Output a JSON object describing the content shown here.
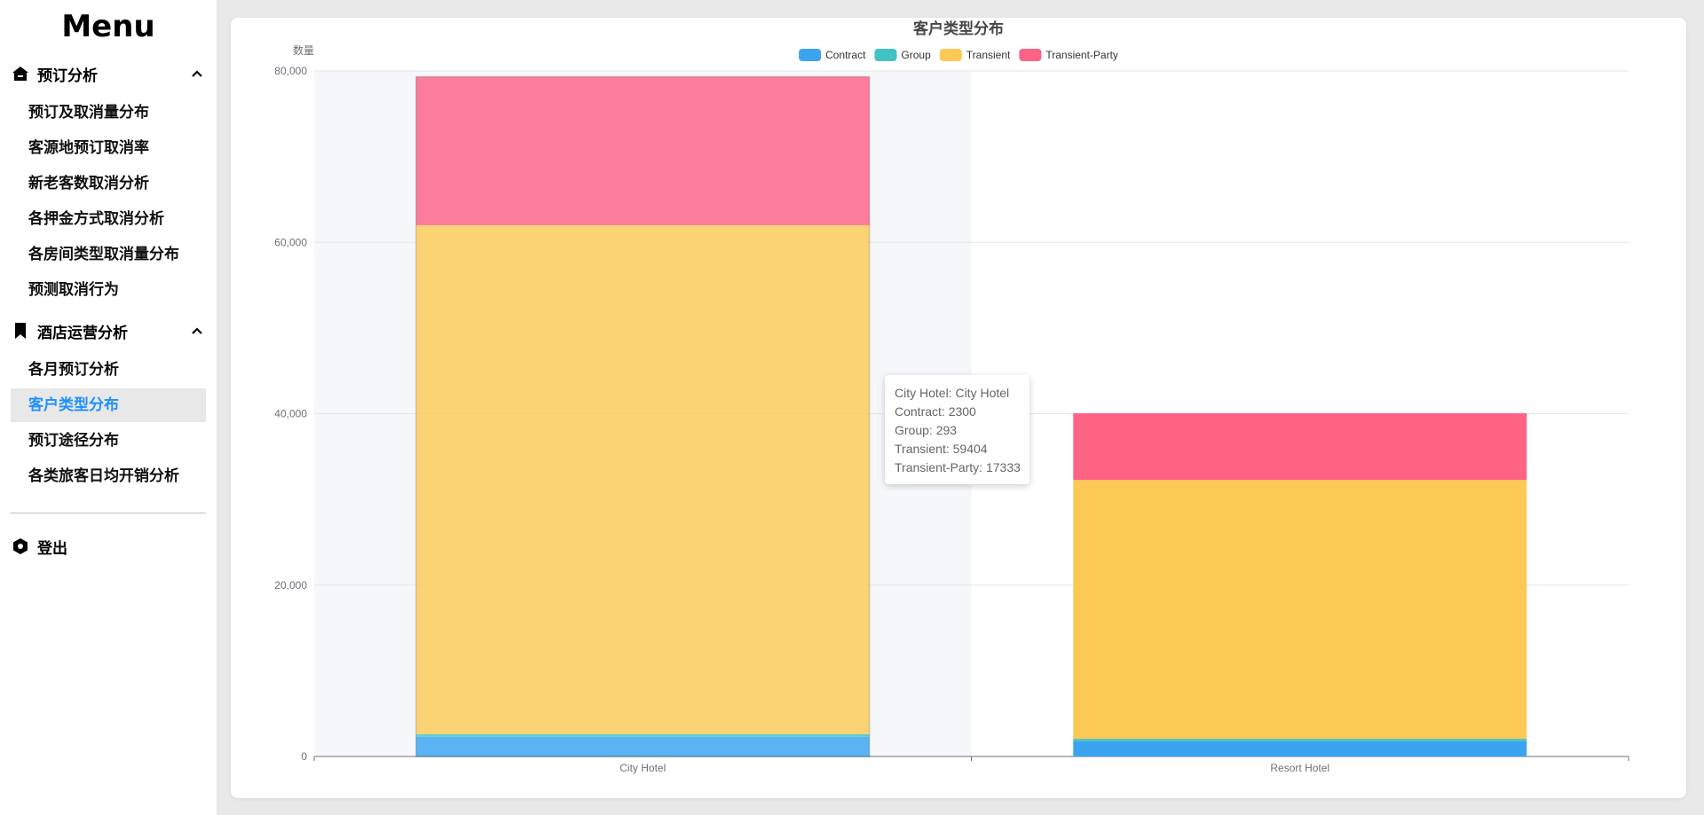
{
  "sidebar": {
    "title": "Menu",
    "groups": [
      {
        "label": "预订分析",
        "items": [
          "预订及取消量分布",
          "客源地预订取消率",
          "新老客数取消分析",
          "各押金方式取消分析",
          "各房间类型取消量分布",
          "预测取消行为"
        ]
      },
      {
        "label": "酒店运营分析",
        "items": [
          "各月预订分析",
          "客户类型分布",
          "预订途径分布",
          "各类旅客日均开销分析"
        ]
      }
    ],
    "active_item": "客户类型分布",
    "logout_label": "登出"
  },
  "chart_data": {
    "type": "bar",
    "stacked": true,
    "title": "客户类型分布",
    "ylabel": "数量",
    "xlabel": "",
    "categories": [
      "City Hotel",
      "Resort Hotel"
    ],
    "series": [
      {
        "name": "Contract",
        "color": "#3ba4f0",
        "values": [
          2300,
          1776
        ]
      },
      {
        "name": "Group",
        "color": "#42c2c4",
        "values": [
          293,
          284
        ]
      },
      {
        "name": "Transient",
        "color": "#fdc955",
        "values": [
          59404,
          30209
        ]
      },
      {
        "name": "Transient-Party",
        "color": "#fe6285",
        "values": [
          17333,
          7791
        ]
      }
    ],
    "ylim": [
      0,
      80000
    ],
    "yticks": [
      "0",
      "20,000",
      "40,000",
      "60,000",
      "80,000"
    ],
    "grid": true,
    "legend_position": "top-center",
    "highlighted_category": "City Hotel"
  },
  "tooltip": {
    "lines": [
      "City Hotel: City Hotel",
      "Contract: 2300",
      "Group: 293",
      "Transient: 59404",
      "Transient-Party: 17333"
    ]
  }
}
